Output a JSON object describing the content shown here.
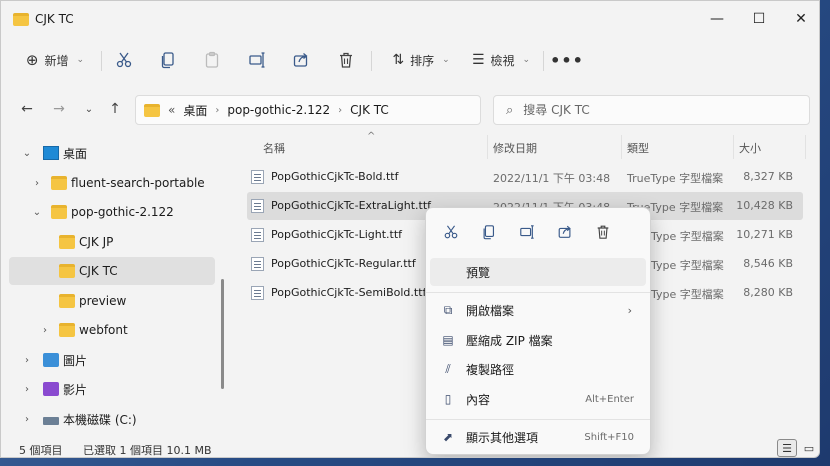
{
  "window": {
    "title": "CJK TC"
  },
  "toolbar": {
    "new_label": "新增",
    "sort_label": "排序",
    "view_label": "檢視",
    "more_label": "•••"
  },
  "address": {
    "overflow": "«",
    "crumbs": [
      "桌面",
      "pop-gothic-2.122",
      "CJK TC"
    ]
  },
  "search": {
    "placeholder": "搜尋 CJK TC"
  },
  "nav": {
    "items": [
      {
        "label": "桌面"
      },
      {
        "label": "fluent-search-portable"
      },
      {
        "label": "pop-gothic-2.122"
      },
      {
        "label": "CJK JP"
      },
      {
        "label": "CJK TC"
      },
      {
        "label": "preview"
      },
      {
        "label": "webfont"
      },
      {
        "label": "圖片"
      },
      {
        "label": "影片"
      },
      {
        "label": "本機磁碟 (C:)"
      }
    ]
  },
  "columns": {
    "name": "名稱",
    "date": "修改日期",
    "type": "類型",
    "size": "大小"
  },
  "files": [
    {
      "name": "PopGothicCjkTc-Bold.ttf",
      "date": "2022/11/1 下午 03:48",
      "type": "TrueType 字型檔案",
      "size": "8,327 KB"
    },
    {
      "name": "PopGothicCjkTc-ExtraLight.ttf",
      "date": "2022/11/1 下午 03:48",
      "type": "TrueType 字型檔案",
      "size": "10,428 KB"
    },
    {
      "name": "PopGothicCjkTc-Light.ttf",
      "date": "",
      "type": "Type 字型檔案",
      "size": "10,271 KB"
    },
    {
      "name": "PopGothicCjkTc-Regular.ttf",
      "date": "",
      "type": "Type 字型檔案",
      "size": "8,546 KB"
    },
    {
      "name": "PopGothicCjkTc-SemiBold.ttf",
      "date": "",
      "type": "Type 字型檔案",
      "size": "8,280 KB"
    }
  ],
  "status": {
    "count": "5 個項目",
    "selected": "已選取 1 個項目 10.1 MB"
  },
  "context_menu": {
    "preview": "預覽",
    "open_with": "開啟檔案",
    "compress_zip": "壓縮成 ZIP 檔案",
    "copy_path": "複製路徑",
    "properties": "內容",
    "properties_shortcut": "Alt+Enter",
    "more_options": "顯示其他選項",
    "more_options_shortcut": "Shift+F10"
  },
  "icons": {
    "title": "folder-icon",
    "accent_folder": "#f5c542",
    "selection": "#dcdcdc"
  }
}
